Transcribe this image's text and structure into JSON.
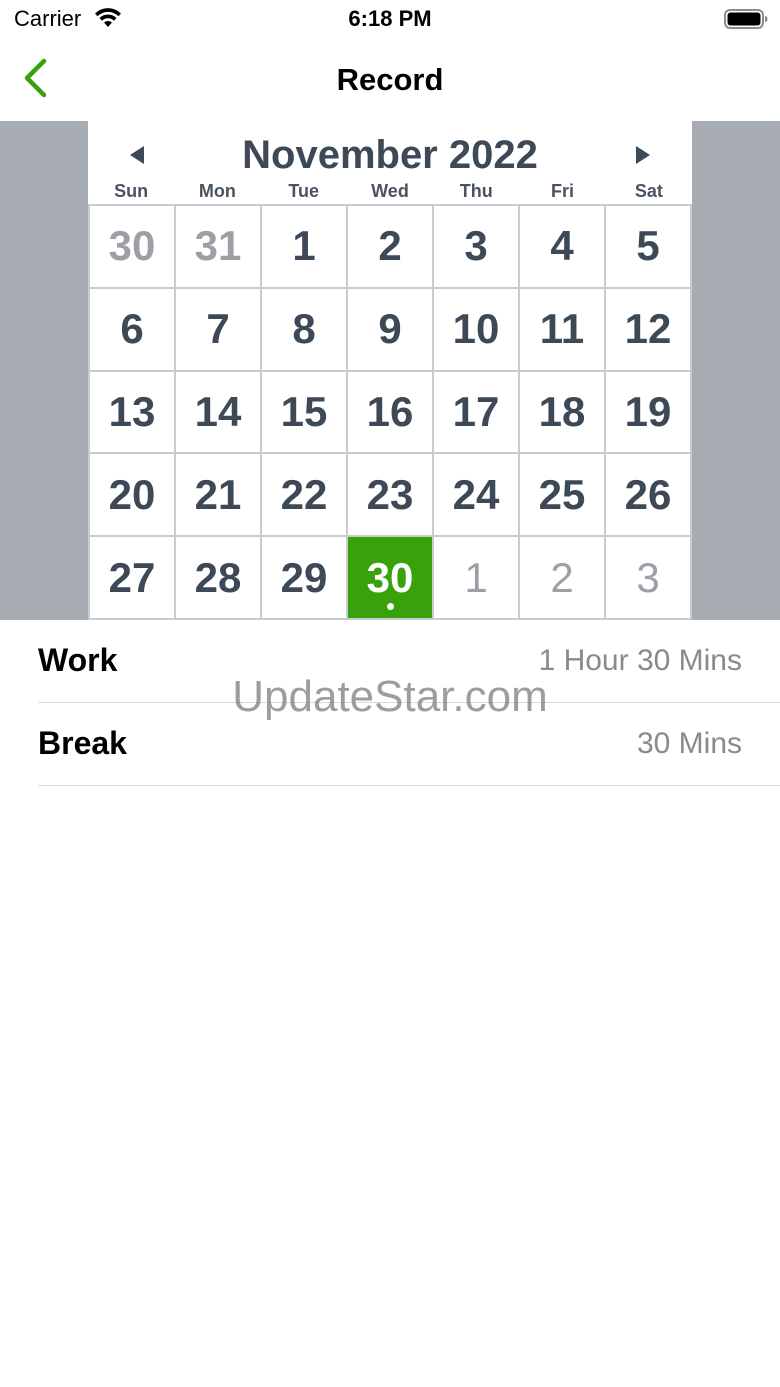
{
  "status_bar": {
    "carrier": "Carrier",
    "time": "6:18 PM",
    "wifi_icon": "wifi-icon",
    "battery_icon": "battery-icon"
  },
  "nav": {
    "title": "Record",
    "back_icon": "chevron-left-icon",
    "accent_color": "#39a10a"
  },
  "calendar": {
    "month_title": "November 2022",
    "prev_icon": "triangle-left-icon",
    "next_icon": "triangle-right-icon",
    "weekdays": [
      "Sun",
      "Mon",
      "Tue",
      "Wed",
      "Thu",
      "Fri",
      "Sat"
    ],
    "weeks": [
      [
        "30",
        "31",
        "1",
        "2",
        "3",
        "4",
        "5"
      ],
      [
        "6",
        "7",
        "8",
        "9",
        "10",
        "11",
        "12"
      ],
      [
        "13",
        "14",
        "15",
        "16",
        "17",
        "18",
        "19"
      ],
      [
        "20",
        "21",
        "22",
        "23",
        "24",
        "25",
        "26"
      ],
      [
        "27",
        "28",
        "29",
        "30",
        "1",
        "2",
        "3"
      ]
    ],
    "selected_date": "30",
    "selected_color": "#39a10a",
    "band_color": "#a7abb2"
  },
  "records": [
    {
      "label": "Work",
      "value": "1 Hour 30 Mins"
    },
    {
      "label": "Break",
      "value": "30 Mins"
    }
  ],
  "watermark": "UpdateStar.com"
}
